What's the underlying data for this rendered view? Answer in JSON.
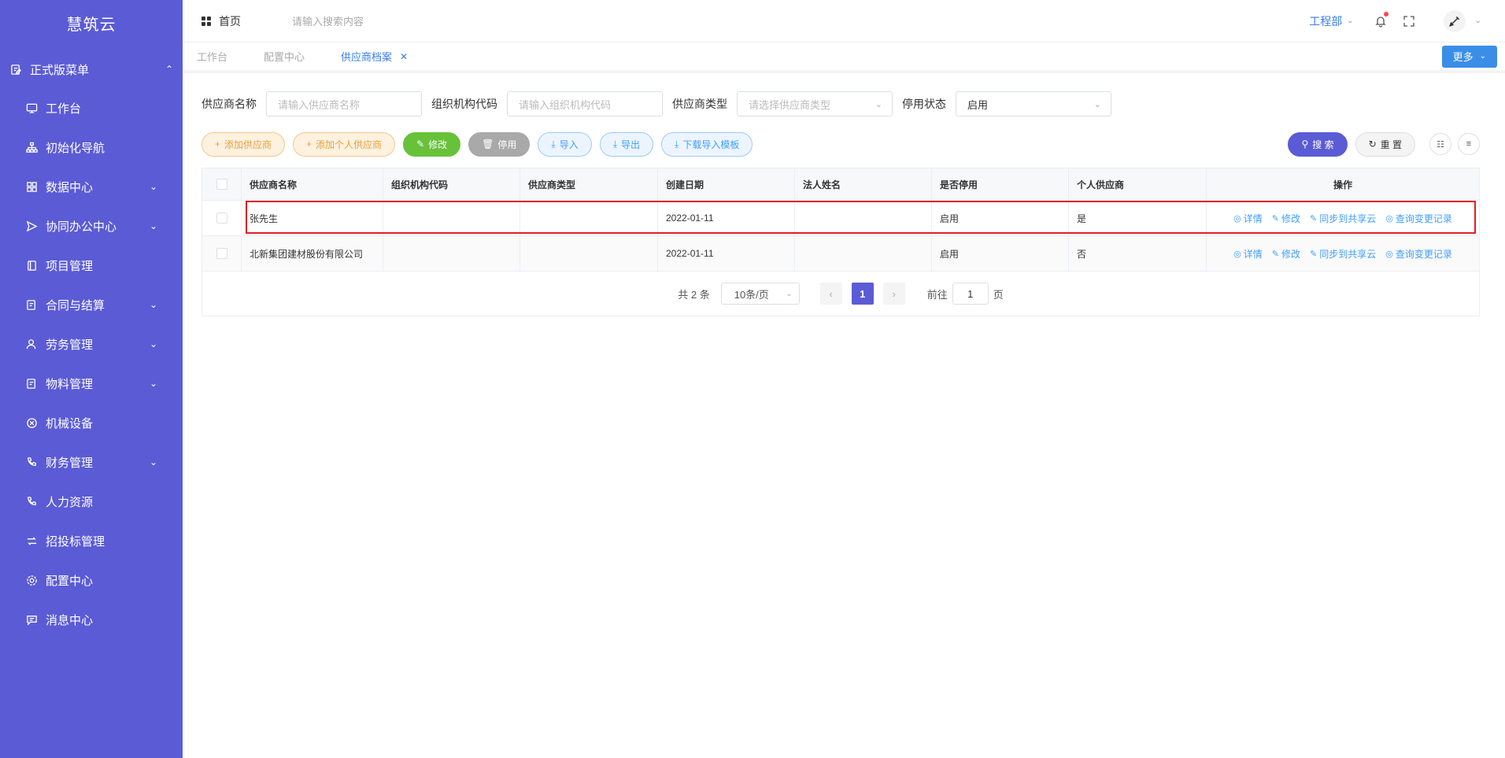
{
  "sidebar": {
    "logo": "慧筑云",
    "group": {
      "label": "正式版菜单"
    },
    "items": [
      {
        "label": "工作台",
        "icon": "monitor-icon",
        "expandable": false
      },
      {
        "label": "初始化导航",
        "icon": "sitemap-icon",
        "expandable": false
      },
      {
        "label": "数据中心",
        "icon": "grid-icon",
        "expandable": true
      },
      {
        "label": "协同办公中心",
        "icon": "send-icon",
        "expandable": true
      },
      {
        "label": "项目管理",
        "icon": "book-icon",
        "expandable": false
      },
      {
        "label": "合同与结算",
        "icon": "edit-doc-icon",
        "expandable": true
      },
      {
        "label": "劳务管理",
        "icon": "user-group-icon",
        "expandable": true
      },
      {
        "label": "物料管理",
        "icon": "edit-doc-icon",
        "expandable": true
      },
      {
        "label": "机械设备",
        "icon": "circle-x-icon",
        "expandable": false
      },
      {
        "label": "财务管理",
        "icon": "phone-icon",
        "expandable": true
      },
      {
        "label": "人力资源",
        "icon": "phone-icon",
        "expandable": false
      },
      {
        "label": "招投标管理",
        "icon": "transfer-icon",
        "expandable": false
      },
      {
        "label": "配置中心",
        "icon": "gear-icon",
        "expandable": false
      },
      {
        "label": "消息中心",
        "icon": "message-icon",
        "expandable": false
      }
    ]
  },
  "header": {
    "home": "首页",
    "search_placeholder": "请输入搜索内容",
    "department": "工程部"
  },
  "tabs": [
    {
      "label": "工作台",
      "active": false
    },
    {
      "label": "配置中心",
      "active": false
    },
    {
      "label": "供应商档案",
      "active": true
    }
  ],
  "more_button": "更多",
  "filters": {
    "supplier_name_label": "供应商名称",
    "supplier_name_placeholder": "请输入供应商名称",
    "org_code_label": "组织机构代码",
    "org_code_placeholder": "请输入组织机构代码",
    "supplier_type_label": "供应商类型",
    "supplier_type_placeholder": "请选择供应商类型",
    "status_label": "停用状态",
    "status_value": "启用"
  },
  "actions": {
    "add_supplier": "添加供应商",
    "add_personal_supplier": "添加个人供应商",
    "edit": "修改",
    "disable": "停用",
    "import": "导入",
    "export": "导出",
    "download_template": "下载导入模板",
    "search": "搜 索",
    "reset": "重 置"
  },
  "table": {
    "columns": [
      "供应商名称",
      "组织机构代码",
      "供应商类型",
      "创建日期",
      "法人姓名",
      "是否停用",
      "个人供应商",
      "操作"
    ],
    "rows": [
      {
        "name": "张先生",
        "org_code": "",
        "type": "",
        "created": "2022-01-11",
        "legal_person": "",
        "status": "启用",
        "personal": "是"
      },
      {
        "name": "北新集团建材股份有限公司",
        "org_code": "",
        "type": "",
        "created": "2022-01-11",
        "legal_person": "",
        "status": "启用",
        "personal": "否"
      }
    ],
    "row_ops": {
      "detail": "详情",
      "edit": "修改",
      "sync": "同步到共享云",
      "history": "查询变更记录"
    }
  },
  "pagination": {
    "total": "共 2 条",
    "page_size": "10条/页",
    "current_page": "1",
    "goto_label": "前往",
    "goto_value": "1",
    "page_suffix": "页"
  },
  "colors": {
    "sidebar": "#5b5bd6",
    "accent": "#3a7ee8",
    "highlight": "#e02020"
  }
}
